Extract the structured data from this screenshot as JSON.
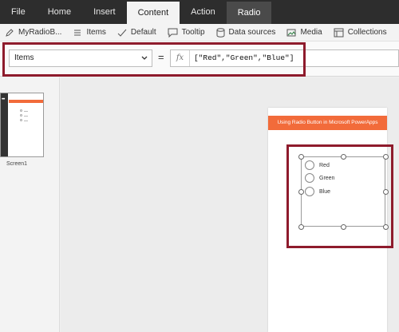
{
  "ribbon": {
    "tabs": [
      {
        "label": "File"
      },
      {
        "label": "Home"
      },
      {
        "label": "Insert"
      },
      {
        "label": "Content"
      },
      {
        "label": "Action"
      },
      {
        "label": "Radio"
      }
    ],
    "active_tab": "Content"
  },
  "commands": [
    {
      "label": "MyRadioB...",
      "icon": "pencil-icon"
    },
    {
      "label": "Items",
      "icon": "list-icon"
    },
    {
      "label": "Default",
      "icon": "check-icon"
    },
    {
      "label": "Tooltip",
      "icon": "comment-icon"
    },
    {
      "label": "Data sources",
      "icon": "database-icon"
    },
    {
      "label": "Media",
      "icon": "image-icon"
    },
    {
      "label": "Collections",
      "icon": "collection-icon"
    }
  ],
  "formula_bar": {
    "property": "Items",
    "equals": "=",
    "fx": "fx",
    "formula": "[\"Red\",\"Green\",\"Blue\"]"
  },
  "screens": {
    "items": [
      {
        "label": "Screen1"
      }
    ]
  },
  "canvas": {
    "header_title": "Using Radio Button in Microsoft PowerApps",
    "radio_options": [
      "Red",
      "Green",
      "Blue"
    ]
  },
  "colors": {
    "ribbon_bg": "#2d2d2d",
    "header_orange": "#f26b3a",
    "highlight_red": "#8e1b2c"
  }
}
